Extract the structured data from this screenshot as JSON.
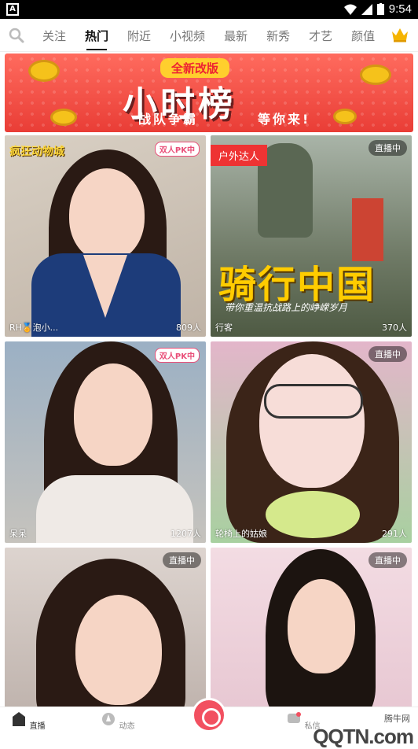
{
  "status_bar": {
    "time": "9:54",
    "app_letter": "A"
  },
  "tabs": [
    "关注",
    "热门",
    "附近",
    "小视频",
    "最新",
    "新秀",
    "才艺",
    "颜值"
  ],
  "active_tab": "热门",
  "banner": {
    "top_text": "全新改版",
    "main_text": "小时榜",
    "line_left": "战队争霸",
    "line_right": "等你来!"
  },
  "cards": [
    {
      "name": "RH🏅泡小...",
      "count": "809人",
      "badge": "双人PK中",
      "overlay_text": "疯狂动物城"
    },
    {
      "name": "行客",
      "count": "370人",
      "badge": "直播中",
      "overlay_text": "骑行中国",
      "sub_overlay": "带你重温抗战路上的峥嵘岁月",
      "corner_label": "户外达人"
    },
    {
      "name": "呆呆",
      "count": "1207人",
      "badge": "双人PK中"
    },
    {
      "name": "轮椅上的姑娘",
      "count": "291人",
      "badge": "直播中"
    },
    {
      "name": "",
      "count": "",
      "badge": "直播中"
    },
    {
      "name": "",
      "count": "",
      "badge": "直播中"
    }
  ],
  "bottom_nav": {
    "items": [
      "直播",
      "动态",
      "私信"
    ],
    "watermark_top": "腾牛网",
    "watermark_main": "QQTN.com"
  },
  "colors": {
    "accent": "#f25060",
    "banner_red": "#e93d36",
    "crown": "#f5b400"
  }
}
